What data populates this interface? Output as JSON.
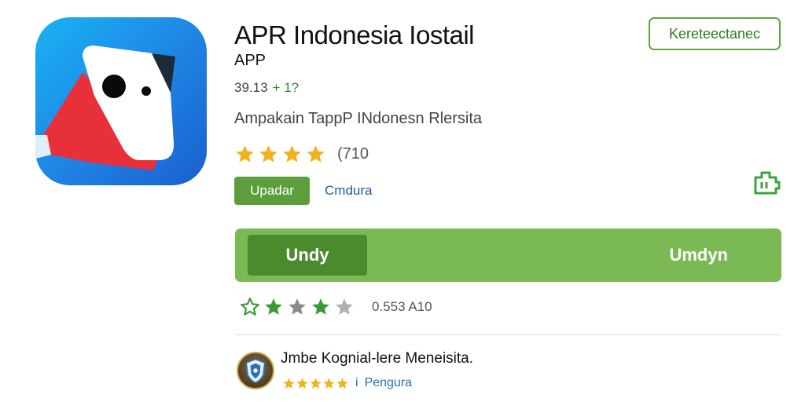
{
  "app": {
    "title": "APR Indonesia Iostail",
    "subtitle": "APP",
    "version": "39.13",
    "version_delta": "+ 1?",
    "description": "Ampakain TappP INdonesn Rlersita",
    "rating_count": "(710",
    "update_badge": "Upadar",
    "category_link": "Cmdura",
    "icon": "app-logo-icon"
  },
  "header": {
    "badge_label": "Kereteectanec",
    "side_icon": "install-device-icon"
  },
  "progress": {
    "left_label": "Undy",
    "right_label": "Umdyn",
    "fraction": 0.23,
    "colors": {
      "track": "#7ab954",
      "fill": "#4b8a2d"
    }
  },
  "stats": {
    "downloads": "0.553 A10",
    "stars": [
      {
        "kind": "outline",
        "color": "#3c9a34"
      },
      {
        "kind": "filled",
        "color": "#3c9a34"
      },
      {
        "kind": "filled",
        "color": "#8a8a8a"
      },
      {
        "kind": "filled",
        "color": "#3c9a34"
      },
      {
        "kind": "filled",
        "color": "#b0b0b0"
      }
    ]
  },
  "developer": {
    "name": "Jmbe Kognial-lere Meneisita.",
    "separator": "i",
    "link": "Pengura",
    "avatar_icon": "shield-avatar-icon"
  },
  "rating": {
    "stars": 4,
    "color": "#f2b21d"
  },
  "colors": {
    "accent": "#5c9e3b",
    "link": "#1e5f9e",
    "star": "#f2b21d"
  }
}
